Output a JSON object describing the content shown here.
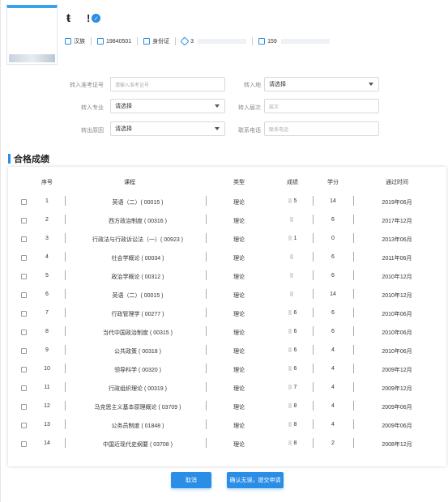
{
  "profile": {
    "name_char": "ŧ",
    "name_mark": "!",
    "ethnicity": "汉族",
    "birthdate": "19840501",
    "id_type": "身份证",
    "id_number": "3",
    "phone": "159"
  },
  "form": {
    "exam_id_label": "转入准考证号",
    "exam_id_placeholder": "请输入准考证号",
    "region_label": "转入地",
    "region_value": "请选择",
    "major_label": "转入专业",
    "major_value": "请选择",
    "level_label": "转入层次",
    "level_placeholder": "层次",
    "reason_label": "转出原因",
    "reason_value": "请选择",
    "phone_label": "联系电话",
    "phone_placeholder": "联系电话"
  },
  "section": {
    "title": "合格成绩"
  },
  "table": {
    "headers": {
      "seq": "序号",
      "course": "课程",
      "type": "类型",
      "score": "成绩",
      "credit": "学分",
      "pass_time": "通过时间"
    },
    "rows": [
      {
        "seq": "1",
        "course": "英语（二）( 00015 )",
        "type": "理论",
        "score": "5",
        "credit": "14",
        "time": "2019年06月"
      },
      {
        "seq": "2",
        "course": "西方政治制度 ( 00316 )",
        "type": "理论",
        "score": "",
        "credit": "6",
        "time": "2017年12月"
      },
      {
        "seq": "3",
        "course": "行政法与行政诉讼法（一）( 00923 )",
        "type": "理论",
        "score": "1",
        "credit": "0",
        "time": "2013年06月"
      },
      {
        "seq": "4",
        "course": "社会学概论 ( 00034 )",
        "type": "理论",
        "score": "",
        "credit": "6",
        "time": "2011年06月"
      },
      {
        "seq": "5",
        "course": "政治学概论 ( 00312 )",
        "type": "理论",
        "score": "",
        "credit": "6",
        "time": "2010年12月"
      },
      {
        "seq": "6",
        "course": "英语（二）( 00015 )",
        "type": "理论",
        "score": "",
        "credit": "14",
        "time": "2010年12月"
      },
      {
        "seq": "7",
        "course": "行政管理学 ( 00277 )",
        "type": "理论",
        "score": "6",
        "credit": "6",
        "time": "2010年06月"
      },
      {
        "seq": "8",
        "course": "当代中国政治制度 ( 00315 )",
        "type": "理论",
        "score": "6",
        "credit": "6",
        "time": "2010年06月"
      },
      {
        "seq": "9",
        "course": "公共政策 ( 00318 )",
        "type": "理论",
        "score": "6",
        "credit": "4",
        "time": "2010年06月"
      },
      {
        "seq": "10",
        "course": "领导科学 ( 00320 )",
        "type": "理论",
        "score": "6",
        "credit": "4",
        "time": "2009年12月"
      },
      {
        "seq": "11",
        "course": "行政组织理论 ( 00319 )",
        "type": "理论",
        "score": "7",
        "credit": "4",
        "time": "2009年12月"
      },
      {
        "seq": "12",
        "course": "马克思主义基本原理概论 ( 03709 )",
        "type": "理论",
        "score": "8",
        "credit": "4",
        "time": "2009年06月"
      },
      {
        "seq": "13",
        "course": "公务员制度 ( 01848 )",
        "type": "理论",
        "score": "8",
        "credit": "4",
        "time": "2009年06月"
      },
      {
        "seq": "14",
        "course": "中国近现代史纲要 ( 03708 )",
        "type": "理论",
        "score": "8",
        "credit": "2",
        "time": "2008年12月"
      }
    ]
  },
  "actions": {
    "cancel": "取消",
    "confirm": "确认无误，提交申请"
  },
  "colors": {
    "accent": "#2b8ee6"
  }
}
